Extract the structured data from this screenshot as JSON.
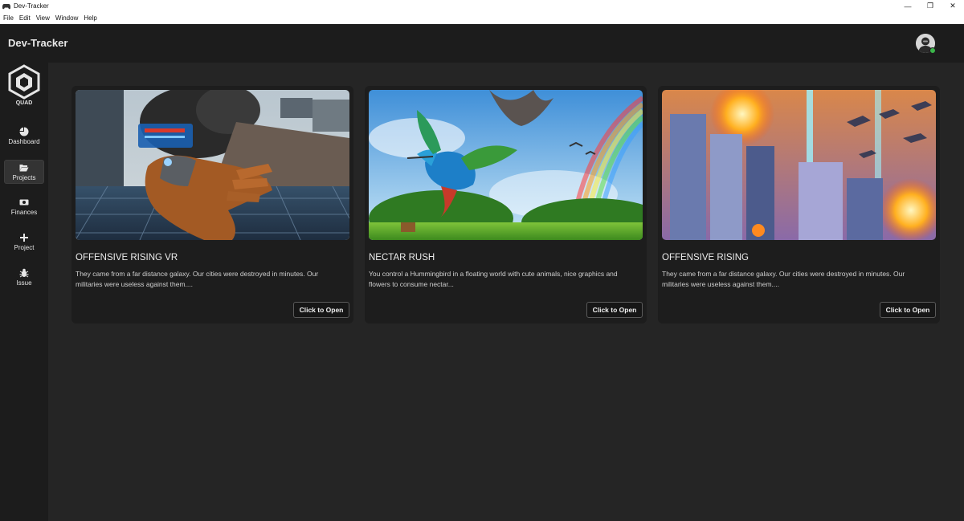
{
  "window": {
    "title": "Dev-Tracker",
    "controls": {
      "minimize": "—",
      "restore": "❐",
      "close": "✕"
    }
  },
  "menu": [
    "File",
    "Edit",
    "View",
    "Window",
    "Help"
  ],
  "header": {
    "title": "Dev-Tracker",
    "status_color": "#3bb54a"
  },
  "sidebar": {
    "logo_text": "QUAD",
    "items": [
      {
        "label": "Dashboard",
        "icon": "pie-chart-icon",
        "active": false
      },
      {
        "label": "Projects",
        "icon": "folder-open-icon",
        "active": true
      },
      {
        "label": "Finances",
        "icon": "money-icon",
        "active": false
      },
      {
        "label": "Project",
        "icon": "plus-icon",
        "active": false
      },
      {
        "label": "Issue",
        "icon": "bug-icon",
        "active": false
      }
    ]
  },
  "projects": [
    {
      "title": "OFFENSIVE RISING VR",
      "description": "They came from a far distance galaxy. Our cities were destroyed in minutes. Our militaries were useless against them....",
      "button": "Click to Open"
    },
    {
      "title": "NECTAR RUSH",
      "description": "You control a Hummingbird in a floating world with cute animals, nice graphics and flowers to consume nectar...",
      "button": "Click to Open"
    },
    {
      "title": "OFFENSIVE RISING",
      "description": "They came from a far distance galaxy. Our cities were destroyed in minutes. Our militaries were useless against them....",
      "button": "Click to Open"
    }
  ]
}
